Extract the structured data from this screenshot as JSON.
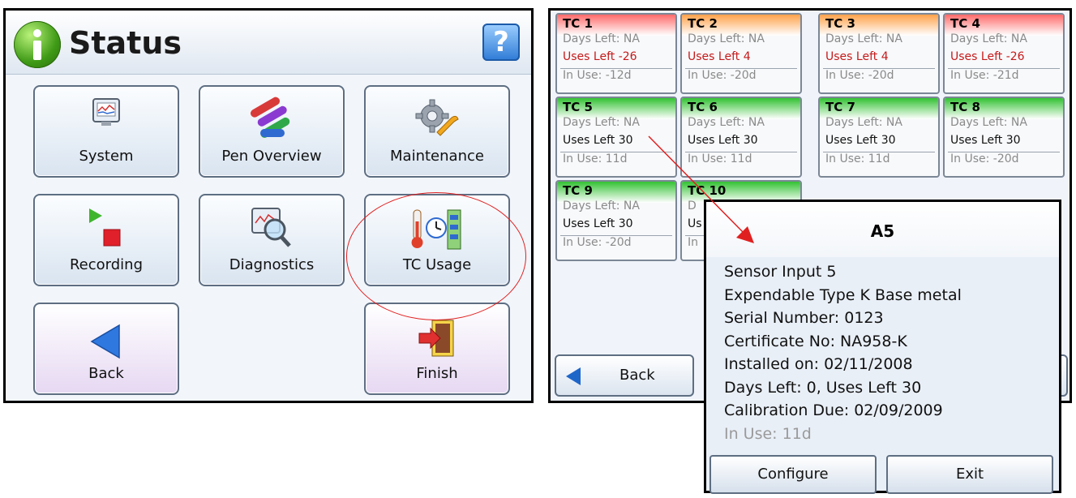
{
  "status_screen": {
    "title": "Status",
    "help_symbol": "?",
    "buttons": [
      {
        "label": "System",
        "icon": "monitor-icon"
      },
      {
        "label": "Pen Overview",
        "icon": "pens-icon"
      },
      {
        "label": "Maintenance",
        "icon": "gear-wrench-icon"
      },
      {
        "label": "Recording",
        "icon": "play-stop-icon"
      },
      {
        "label": "Diagnostics",
        "icon": "magnifier-icon"
      },
      {
        "label": "TC Usage",
        "icon": "thermometer-clock-icon"
      },
      {
        "label": "Back",
        "icon": "back-arrow-icon"
      },
      {
        "label": "Finish",
        "icon": "exit-door-icon"
      }
    ]
  },
  "tc_usage": {
    "cards": [
      {
        "name": "TC 1",
        "days_left": "Days Left: NA",
        "uses_left": "Uses Left -26",
        "in_use": "In Use: -12d",
        "status": "red"
      },
      {
        "name": "TC 2",
        "days_left": "Days Left: NA",
        "uses_left": "Uses Left 4",
        "in_use": "In Use: -20d",
        "status": "orange"
      },
      {
        "name": "TC 3",
        "days_left": "Days Left: NA",
        "uses_left": "Uses Left 4",
        "in_use": "In Use: -20d",
        "status": "orange"
      },
      {
        "name": "TC 4",
        "days_left": "Days Left: NA",
        "uses_left": "Uses Left -26",
        "in_use": "In Use: -21d",
        "status": "red"
      },
      {
        "name": "TC 5",
        "days_left": "Days Left: NA",
        "uses_left": "Uses Left 30",
        "in_use": "In Use: 11d",
        "status": "green"
      },
      {
        "name": "TC 6",
        "days_left": "Days Left: NA",
        "uses_left": "Uses Left 30",
        "in_use": "In Use: 11d",
        "status": "green"
      },
      {
        "name": "TC 7",
        "days_left": "Days Left: NA",
        "uses_left": "Uses Left 30",
        "in_use": "In Use: 11d",
        "status": "green"
      },
      {
        "name": "TC 8",
        "days_left": "Days Left: NA",
        "uses_left": "Uses Left 30",
        "in_use": "In Use: -20d",
        "status": "green"
      },
      {
        "name": "TC 9",
        "days_left": "Days Left: NA",
        "uses_left": "Uses Left 30",
        "in_use": "In Use: -20d",
        "status": "green"
      },
      {
        "name": "TC 10",
        "days_left": "D",
        "uses_left": "Us",
        "in_use": "In",
        "status": "green"
      }
    ],
    "back_label": "Back"
  },
  "popup": {
    "title": "A5",
    "lines": [
      "Sensor Input 5",
      "Expendable Type K Base metal",
      "Serial Number: 0123",
      "Certificate No: NA958-K",
      "Installed on: 02/11/2008",
      "Days Left: 0, Uses Left 30",
      "Calibration Due: 02/09/2009"
    ],
    "in_use": "In Use: 11d",
    "configure_label": "Configure",
    "exit_label": "Exit"
  },
  "colors": {
    "red": "#c51a1a",
    "orange_band": "#ffa24a",
    "green_band": "#33c233",
    "annotation": "#e02020"
  }
}
